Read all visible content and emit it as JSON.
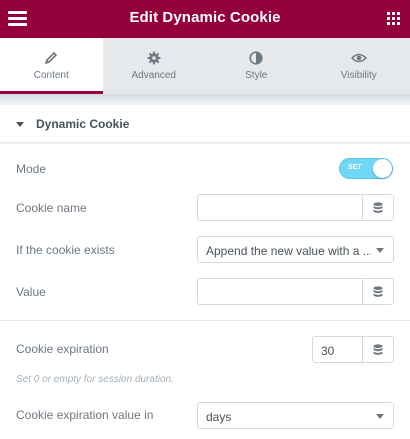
{
  "header": {
    "title": "Edit Dynamic Cookie",
    "menu_icon": "hamburger-icon",
    "apps_icon": "grid-icon",
    "color": "#93003c"
  },
  "tabs": [
    {
      "label": "Content",
      "icon": "pencil-icon",
      "active": true
    },
    {
      "label": "Advanced",
      "icon": "gear-icon",
      "active": false
    },
    {
      "label": "Style",
      "icon": "half-circle-icon",
      "active": false
    },
    {
      "label": "Visibility",
      "icon": "eye-icon",
      "active": false
    }
  ],
  "section": {
    "title": "Dynamic Cookie"
  },
  "controls": {
    "mode": {
      "label": "Mode",
      "toggle_text": "SET",
      "on": true
    },
    "cookie_name": {
      "label": "Cookie name",
      "value": ""
    },
    "cookie_exists": {
      "label": "If the cookie exists",
      "value": "Append the new value with a ..."
    },
    "value": {
      "label": "Value",
      "value": ""
    },
    "expiration": {
      "label": "Cookie expiration",
      "value": "30",
      "help": "Set 0 or empty for session duration."
    },
    "expiration_unit": {
      "label": "Cookie expiration value in",
      "value": "days"
    }
  }
}
